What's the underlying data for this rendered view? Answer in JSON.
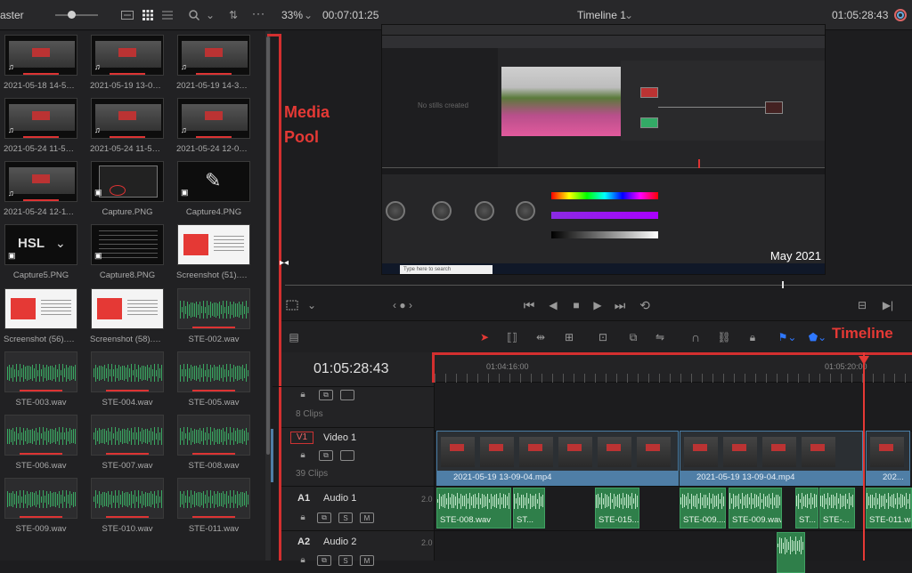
{
  "topbar": {
    "pool_title": "aster",
    "zoom": "33%",
    "source_timecode": "00:07:01:25",
    "timeline_name": "Timeline 1",
    "record_timecode": "01:05:28:43",
    "more": "···"
  },
  "media_pool": {
    "items": [
      {
        "label": "2021-05-18 14-50-...",
        "kind": "video"
      },
      {
        "label": "2021-05-19 13-09-...",
        "kind": "video"
      },
      {
        "label": "2021-05-19 14-31-...",
        "kind": "video"
      },
      {
        "label": "2021-05-24 11-53-...",
        "kind": "video"
      },
      {
        "label": "2021-05-24 11-55-...",
        "kind": "video"
      },
      {
        "label": "2021-05-24 12-06-...",
        "kind": "video"
      },
      {
        "label": "2021-05-24 12-11-...",
        "kind": "video"
      },
      {
        "label": "Capture.PNG",
        "kind": "image"
      },
      {
        "label": "Capture4.PNG",
        "kind": "image"
      },
      {
        "label": "Capture5.PNG",
        "kind": "image"
      },
      {
        "label": "Capture8.PNG",
        "kind": "image"
      },
      {
        "label": "Screenshot (51).png",
        "kind": "shot"
      },
      {
        "label": "Screenshot (56).png",
        "kind": "shot"
      },
      {
        "label": "Screenshot (58).png",
        "kind": "shot"
      },
      {
        "label": "STE-002.wav",
        "kind": "audio"
      },
      {
        "label": "STE-003.wav",
        "kind": "audio"
      },
      {
        "label": "STE-004.wav",
        "kind": "audio"
      },
      {
        "label": "STE-005.wav",
        "kind": "audio"
      },
      {
        "label": "STE-006.wav",
        "kind": "audio"
      },
      {
        "label": "STE-007.wav",
        "kind": "audio"
      },
      {
        "label": "STE-008.wav",
        "kind": "audio"
      },
      {
        "label": "STE-009.wav",
        "kind": "audio"
      },
      {
        "label": "STE-010.wav",
        "kind": "audio"
      },
      {
        "label": "STE-011.wav",
        "kind": "audio"
      }
    ],
    "hsl_text": "HSL"
  },
  "annotations": {
    "media_pool_line1": "Media",
    "media_pool_line2": "Pool",
    "timeline": "Timeline"
  },
  "viewer": {
    "overlay_date": "May 2021",
    "no_stills": "No stills created",
    "taskbar_search": "Type here to search"
  },
  "timeline": {
    "timecode": "01:05:28:43",
    "ruler_marks": [
      "01:04:16:00",
      "01:05:20:00"
    ],
    "tracks": {
      "empty_clips": "8 Clips",
      "v1_badge": "V1",
      "v1_name": "Video 1",
      "v1_clips": "39 Clips",
      "a1_badge": "A1",
      "a1_name": "Audio 1",
      "a1_level": "2.0",
      "a2_badge": "A2",
      "a2_name": "Audio 2",
      "a2_level": "2.0"
    },
    "video_clips": [
      "2021-05-19 13-09-04.mp4",
      "2021-05-19 13-09-04.mp4",
      "202..."
    ],
    "audio_clips": [
      "STE-008.wav",
      "ST...",
      "STE-015....",
      "STE-009....",
      "STE-009.wav",
      "ST...",
      "STE-...",
      "STE-011.wav"
    ],
    "audio2_clips": [
      ""
    ]
  },
  "colors": {
    "accent_red": "#d32f2f",
    "video_clip": "#4f7ea6",
    "audio_clip": "#2f7f4a",
    "playhead": "#e53935"
  }
}
